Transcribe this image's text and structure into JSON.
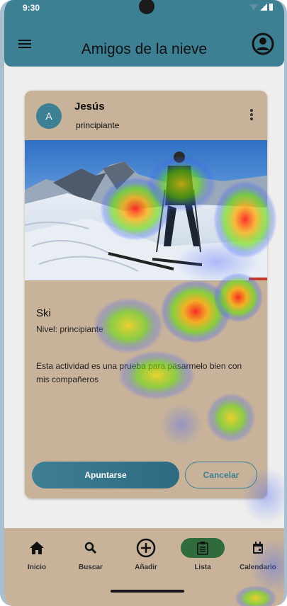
{
  "status_bar": {
    "time": "9:30"
  },
  "app_bar": {
    "title": "Amigos de la nieve",
    "menu_icon": "menu-icon",
    "account_icon": "account-circle-icon"
  },
  "card": {
    "avatar_letter": "A",
    "user_name": "Jesús",
    "user_level": "principiante",
    "more_icon": "more-vert-icon",
    "activity_title": "Ski",
    "activity_level": "Nivel: principiante",
    "description": "Esta actividad es una prueba para pasarmelo bien con mis compañeros",
    "join_button": "Apuntarse",
    "cancel_button": "Cancelar"
  },
  "bottom_nav": {
    "items": [
      {
        "label": "Inicio",
        "icon": "home-icon"
      },
      {
        "label": "Buscar",
        "icon": "search-icon"
      },
      {
        "label": "Añadir",
        "icon": "add-circle-icon"
      },
      {
        "label": "Lista",
        "icon": "clipboard-list-icon"
      },
      {
        "label": "Calendario",
        "icon": "calendar-icon"
      }
    ],
    "active_index": 3
  },
  "colors": {
    "primary": "#3d7f93",
    "card_bg": "#c8b39a",
    "background": "#efeeec",
    "active_pill": "#2f6b3c"
  }
}
